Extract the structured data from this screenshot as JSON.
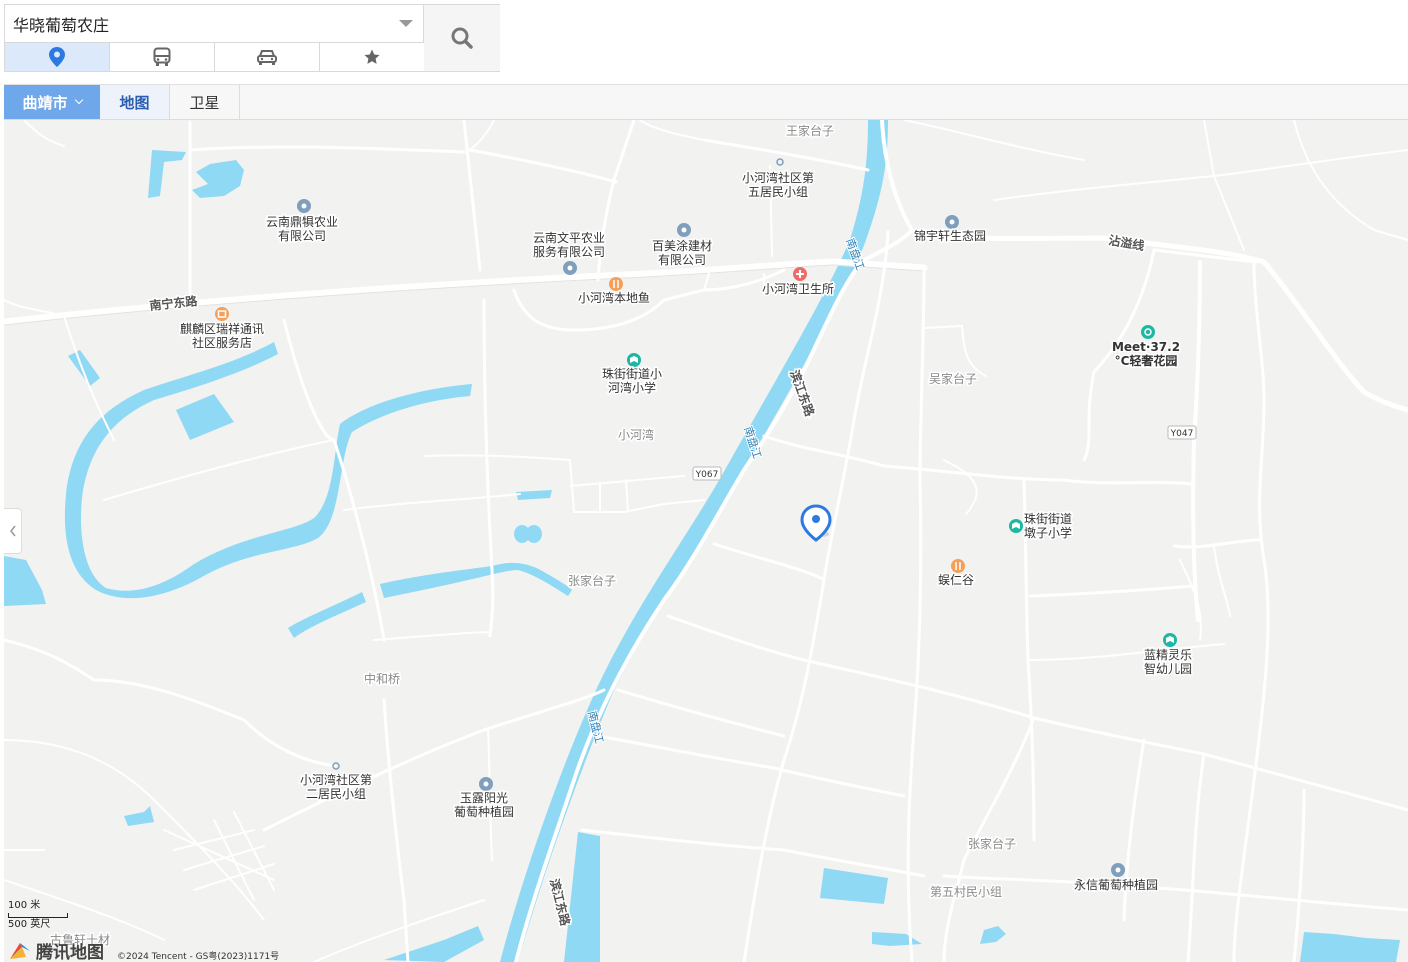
{
  "search": {
    "value": "华晓葡萄农庄"
  },
  "mode_tabs": [
    {
      "icon": "location-pin-icon",
      "active": true
    },
    {
      "icon": "bus-icon",
      "active": false
    },
    {
      "icon": "car-icon",
      "active": false
    },
    {
      "icon": "star-icon",
      "active": false
    }
  ],
  "toolbar": {
    "city": "曲靖市",
    "map_label": "地图",
    "satellite_label": "卫星"
  },
  "colors": {
    "accent": "#6ea7ea",
    "water": "#8fd9f5",
    "road": "#ffffff",
    "land": "#f2f2f0",
    "pin": "#2a7ae2",
    "poi_gray": "#7f9fbd",
    "poi_orange": "#f5a05a",
    "poi_teal": "#1eb8a2",
    "poi_red": "#f06a6a"
  },
  "map": {
    "roads": {
      "nanning_east": "南宁东路",
      "zhanyi": "沾溢线",
      "binjiang_east_1": "滨江东路",
      "binjiang_east_2": "滨江东路"
    },
    "rivers": {
      "nanpan_1": "南盘江",
      "nanpan_2": "南盘江",
      "nanpan_3": "南盘江"
    },
    "route_badges": {
      "y067": "Y067",
      "y047": "Y047"
    },
    "place_labels": {
      "wangjiataizi": "王家台子",
      "wujiataizi": "吴家台子",
      "xiaohewan": "小河湾",
      "zhangjiataizi_1": "张家台子",
      "zhongheqiao": "中和桥",
      "zhangjiataizi_2": "张家台子",
      "diwucun": "第五村民小组",
      "guijiatai": "古鲁轩十材"
    },
    "pois": {
      "dingqi_agri": [
        "云南鼎犋农业",
        "有限公司"
      ],
      "wenping_agri": [
        "云南文平农业",
        "服务有限公司"
      ],
      "baimei": [
        "百美涂建材",
        "有限公司"
      ],
      "xhw5": [
        "小河湾社区第",
        "五居民小组"
      ],
      "jinyuxuan": "锦宇轩生态园",
      "xhw_fish": "小河湾本地鱼",
      "xhw_clinic": "小河湾卫生所",
      "qilin_tel": [
        "麒麟区瑞祥通讯",
        "社区服务店"
      ],
      "zhujie_xhw_school": [
        "珠街街道小",
        "河湾小学"
      ],
      "meet372": [
        "Meet·37.2",
        "°C轻奢花园"
      ],
      "zhujie_duizi_school": [
        "珠街街道",
        "墩子小学"
      ],
      "xierengu": "蜈仁谷",
      "lanjing_kg": [
        "蓝精灵乐",
        "智幼儿园"
      ],
      "xhw2": [
        "小河湾社区第",
        "二居民小组"
      ],
      "yulu": [
        "玉露阳光",
        "葡萄种植园"
      ],
      "yongxin": "永信葡萄种植园"
    }
  },
  "scale": {
    "metric": "100 米",
    "imperial": "500 英尺"
  },
  "logo": "腾讯地图",
  "copyright": "©2024 Tencent - GS粤(2023)1171号"
}
